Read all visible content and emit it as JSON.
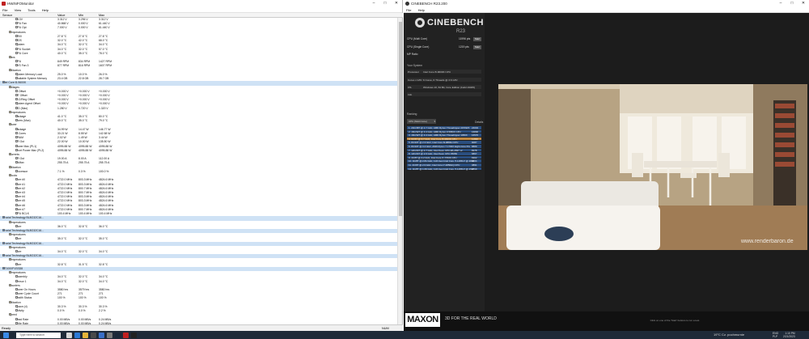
{
  "hwinfo": {
    "title": "HWiNFOMonitor",
    "menu": [
      "File",
      "View",
      "Tools",
      "Help"
    ],
    "columns": [
      "Sensor",
      "Value",
      "Min",
      "Max"
    ],
    "rows": [
      {
        "i": 2,
        "n": "+3.3V",
        "v": "3.312 V",
        "mn": "3.296 V",
        "mx": "3.312 V"
      },
      {
        "i": 2,
        "n": "CPU Fan",
        "v": "40.868 V",
        "mn": "0.000 V",
        "mx": "61.440 V"
      },
      {
        "i": 2,
        "n": "CPU Opt",
        "v": "7.000 V",
        "mn": "0.000 V",
        "mx": "61.440 V"
      },
      {
        "i": 1,
        "n": "Temperatures",
        "h": true
      },
      {
        "i": 2,
        "n": "TZ00",
        "v": "27.8 °C",
        "mn": "27.8 °C",
        "mx": "27.8 °C"
      },
      {
        "i": 2,
        "n": "MOS",
        "v": "32.0 °C",
        "mn": "42.0 °C",
        "mx": "68.0 °C"
      },
      {
        "i": 2,
        "n": "System",
        "v": "34.0 °C",
        "mn": "32.0 °C",
        "mx": "34.0 °C"
      },
      {
        "i": 2,
        "n": "CPU Socket",
        "v": "34.0 °C",
        "mn": "32.0 °C",
        "mx": "57.0 °C"
      },
      {
        "i": 2,
        "n": "CPU Core",
        "v": "40.0 °C",
        "mn": "35.0 °C",
        "mx": "78.0 °C"
      },
      {
        "i": 1,
        "n": "Fans",
        "h": true
      },
      {
        "i": 2,
        "n": "CPU",
        "v": "849 RPM",
        "mn": "834 RPM",
        "mx": "1427 RPM"
      },
      {
        "i": 2,
        "n": "SYS Fan 3",
        "v": "877 RPM",
        "mn": "816 RPM",
        "mx": "1607 RPM"
      },
      {
        "i": 1,
        "n": "Utilization",
        "h": true
      },
      {
        "i": 2,
        "n": "System Memory Load",
        "v": "25.0 %",
        "mn": "10.0 %",
        "mx": "26.0 %"
      },
      {
        "i": 2,
        "n": "Available System Memory",
        "v": "23.4 GB",
        "mn": "22.8 GB",
        "mx": "28.7 GB"
      },
      {
        "i": 0,
        "n": "Intel Core i5-9600K",
        "d": true
      },
      {
        "i": 1,
        "n": "Voltages",
        "h": true
      },
      {
        "i": 2,
        "n": "IA Offset",
        "v": "+0.000 V",
        "mn": "+0.000 V",
        "mx": "+0.000 V"
      },
      {
        "i": 2,
        "n": "GT Offset",
        "v": "+0.000 V",
        "mn": "+0.000 V",
        "mx": "+0.000 V"
      },
      {
        "i": 2,
        "n": "LLC/Ring Offset",
        "v": "+0.000 V",
        "mn": "+0.000 V",
        "mx": "+0.000 V"
      },
      {
        "i": 2,
        "n": "System Agent Offset",
        "v": "+0.000 V",
        "mn": "+0.000 V",
        "mx": "+0.000 V"
      },
      {
        "i": 2,
        "n": "VID (Max)",
        "v": "1.280 V",
        "mn": "0.720 V",
        "mx": "1.320 V"
      },
      {
        "i": 1,
        "n": "Temperatures",
        "h": true
      },
      {
        "i": 2,
        "n": "Package",
        "v": "41.0 °C",
        "mn": "35.0 °C",
        "mx": "80.0 °C"
      },
      {
        "i": 2,
        "n": "Cores (Max)",
        "v": "40.0 °C",
        "mn": "35.0 °C",
        "mx": "79.0 °C"
      },
      {
        "i": 1,
        "n": "Power",
        "h": true
      },
      {
        "i": 2,
        "n": "Package",
        "v": "34.99 W",
        "mn": "14.47 W",
        "mx": "146.77 W"
      },
      {
        "i": 2,
        "n": "IA Cores",
        "v": "33.21 W",
        "mn": "8.55 W",
        "mx": "142.58 W"
      },
      {
        "i": 2,
        "n": "DRAM",
        "v": "2.02 W",
        "mn": "1.49 W",
        "mx": "3.44 W"
      },
      {
        "i": 2,
        "n": "VR Out",
        "v": "22.00 W",
        "mn": "10.00 W",
        "mx": "135.50 W"
      },
      {
        "i": 2,
        "n": "Power Max (PL1)",
        "v": "4095.88 W",
        "mn": "4095.88 W",
        "mx": "4095.88 W"
      },
      {
        "i": 2,
        "n": "Short Power Max (PL2)",
        "v": "4095.88 W",
        "mn": "4095.88 W",
        "mx": "4095.88 W"
      },
      {
        "i": 1,
        "n": "Currents",
        "h": true
      },
      {
        "i": 2,
        "n": "VR Out",
        "v": "19.00 A",
        "mn": "8.00 A",
        "mx": "112.00 A"
      },
      {
        "i": 2,
        "n": "IccMax",
        "v": "255.75 A",
        "mn": "255.75 A",
        "mx": "255.75 A"
      },
      {
        "i": 1,
        "n": "Utilization",
        "h": true
      },
      {
        "i": 2,
        "n": "Processor",
        "v": "7.1 %",
        "mn": "0.3 %",
        "mx": "100.0 %"
      },
      {
        "i": 1,
        "n": "Clocks",
        "h": true
      },
      {
        "i": 2,
        "n": "Core #0",
        "v": "4722.0 MHz",
        "mn": "803.3 MHz",
        "mx": "4824.6 MHz"
      },
      {
        "i": 2,
        "n": "Core #1",
        "v": "4722.0 MHz",
        "mn": "803.3 MHz",
        "mx": "4824.6 MHz"
      },
      {
        "i": 2,
        "n": "Core #2",
        "v": "4722.0 MHz",
        "mn": "800.7 MHz",
        "mx": "4824.6 MHz"
      },
      {
        "i": 2,
        "n": "Core #3",
        "v": "4722.0 MHz",
        "mn": "800.7 MHz",
        "mx": "4824.6 MHz"
      },
      {
        "i": 2,
        "n": "Core #4",
        "v": "4722.0 MHz",
        "mn": "803.3 MHz",
        "mx": "4824.6 MHz"
      },
      {
        "i": 2,
        "n": "Core #5",
        "v": "4722.0 MHz",
        "mn": "803.3 MHz",
        "mx": "4824.6 MHz"
      },
      {
        "i": 2,
        "n": "Core #6",
        "v": "4722.0 MHz",
        "mn": "803.3 MHz",
        "mx": "4824.6 MHz"
      },
      {
        "i": 2,
        "n": "Core #7",
        "v": "4722.0 MHz",
        "mn": "800.7 MHz",
        "mx": "4824.6 MHz"
      },
      {
        "i": 2,
        "n": "CPU BCLK",
        "v": "100.4 MHz",
        "mn": "100.4 MHz",
        "mx": "100.4 MHz"
      },
      {
        "i": 0,
        "n": "Crucial Technology BL8G32C16...",
        "d": true
      },
      {
        "i": 1,
        "n": "Temperatures",
        "h": true
      },
      {
        "i": 2,
        "n": "Core",
        "v": "36.0 °C",
        "mn": "32.8 °C",
        "mx": "36.0 °C"
      },
      {
        "i": 0,
        "n": "Crucial Technology BL8G32C16...",
        "d": true
      },
      {
        "i": 1,
        "n": "Temperatures",
        "h": true
      },
      {
        "i": 2,
        "n": "Core",
        "v": "35.0 °C",
        "mn": "32.0 °C",
        "mx": "35.0 °C"
      },
      {
        "i": 0,
        "n": "Crucial Technology BL8G32C16...",
        "d": true
      },
      {
        "i": 1,
        "n": "Temperatures",
        "h": true
      },
      {
        "i": 2,
        "n": "Core",
        "v": "34.0 °C",
        "mn": "32.0 °C",
        "mx": "34.0 °C"
      },
      {
        "i": 0,
        "n": "Crucial Technology BL8G32C16...",
        "d": true
      },
      {
        "i": 1,
        "n": "Temperatures",
        "h": true
      },
      {
        "i": 2,
        "n": "Core",
        "v": "32.8 °C",
        "mn": "31.5 °C",
        "mx": "32.8 °C"
      },
      {
        "i": 0,
        "n": "CT1000P1SSD8",
        "d": true
      },
      {
        "i": 1,
        "n": "Temperatures",
        "h": true
      },
      {
        "i": 2,
        "n": "Assembly",
        "v": "34.0 °C",
        "mn": "32.0 °C",
        "mx": "34.0 °C"
      },
      {
        "i": 2,
        "n": "Sensor 1",
        "v": "34.0 °C",
        "mn": "32.0 °C",
        "mx": "34.0 °C"
      },
      {
        "i": 1,
        "n": "Counters",
        "h": true
      },
      {
        "i": 2,
        "n": "Power On Hours",
        "v": "3580 hrs",
        "mn": "3579 hrs",
        "mx": "3580 hrs"
      },
      {
        "i": 2,
        "n": "Power Cycle Count",
        "v": "271",
        "mn": "271",
        "mx": "271"
      },
      {
        "i": 2,
        "n": "Health Status",
        "v": "100 %",
        "mn": "100 %",
        "mx": "100 %"
      },
      {
        "i": 1,
        "n": "Utilization",
        "h": true
      },
      {
        "i": 2,
        "n": "Space (d)",
        "v": "30.3 %",
        "mn": "30.3 %",
        "mx": "30.3 %"
      },
      {
        "i": 2,
        "n": "Activity",
        "v": "0.0 %",
        "mn": "0.0 %",
        "mx": "2.2 %"
      },
      {
        "i": 1,
        "n": "Speed",
        "h": true
      },
      {
        "i": 2,
        "n": "Read Rate",
        "v": "0.00 MB/s",
        "mn": "0.00 MB/s",
        "mx": "0.24 MB/s"
      },
      {
        "i": 2,
        "n": "Write Rate",
        "v": "0.00 MB/s",
        "mn": "0.00 MB/s",
        "mx": "0.24 MB/s"
      }
    ],
    "status_left": "Ready",
    "status_right": "NUM"
  },
  "cinebench": {
    "title": "CINEBENCH R23.200",
    "menu": [
      "File",
      "Help"
    ],
    "logo_title": "CINEBENCH",
    "logo_sub": "R23",
    "tests": [
      {
        "label": "CPU (Multi Core)",
        "score": "11996 pts",
        "btn": "Start"
      },
      {
        "label": "CPU (Single Core)",
        "score": "1219 pts",
        "btn": "Start"
      },
      {
        "label": "MP Ratio",
        "score": "",
        "btn": ""
      }
    ],
    "your_system": "Your System",
    "sys": [
      {
        "k": "Processor",
        "v": "Intel Core i5-9600K CPU"
      },
      {
        "k": "Cores x GHz",
        "v": "6 Cores, 6 Threads @ 3.6 GHz"
      },
      {
        "k": "OS",
        "v": "Windows 10, 64 Bit, Core Edition (build 19045)"
      },
      {
        "k": "Info",
        "v": ""
      }
    ],
    "ranking_label": "Ranking",
    "ranking_select": "CPU (Multi Core)",
    "details": "Details",
    "ranking": [
      {
        "n": "1. 24C/48T @ 2.7 GHz, AMD Ryzen Threadripper 2970WX",
        "s": "24004"
      },
      {
        "n": "2. 16C/32T @ 3.4 GHz, AMD Ryzen 9 5950X CPU",
        "s": "16800"
      },
      {
        "n": "3. 16C/32T @ 3.4 GHz, AMD Ryzen Threadripper 1950X",
        "s": "16570"
      },
      {
        "n": "4. 6C/6T @ 3.7 GHz, Intel Core i5-9600K CPU",
        "s": "11996",
        "me": true
      },
      {
        "n": "5. 8C/16T @ 2.3 GHz, Intel Core i9-9880H CPU",
        "s": "9087"
      },
      {
        "n": "6. 8C/16T @ 3.4 GHz, AMD Ryzen 7 1700X Eight-Core Pro",
        "s": "8889"
      },
      {
        "n": "7. 12C/24T @ 2.7 GHz, Intel Xeon CPU E5-2697 v2",
        "s": "8378"
      },
      {
        "n": "8. 12C/24T @ 2.6 GHz, Intel Xeon CPU X5650",
        "s": "6867"
      },
      {
        "n": "9. 4C/8T @ 4.2 GHz, Intel Core i7-7700K CPU",
        "s": "6302"
      },
      {
        "n": "10. 4C/8T @ 2.81 GHz, 11th Gen Intel Core i7-1165G7 @ 28W",
        "s": "4904"
      },
      {
        "n": "11. 4C/8T @ 2.3 GHz, Intel Core i7-4850HQ CPU",
        "s": "3891"
      },
      {
        "n": "12. 4C/8T @ 1.69 GHz, 11th Gen Intel Core i7-1165G7 @ 15W",
        "s": "3769"
      }
    ],
    "legend": [
      "Your Score",
      "Identical System"
    ],
    "brand": "MAXON",
    "tagline": "3D FOR THE REAL WORLD",
    "hint": "Click on one of the 'Start' buttons to run a test.",
    "watermark": "www.renderbaron.de"
  },
  "taskbar": {
    "search": "Type here to search",
    "weather": "19°C  Cz. pochmurnie",
    "time": "1:10 PM",
    "date": "2/21/2023",
    "lang": "ENG PLP"
  },
  "colors": {
    "cb_bar": "#2b4f80",
    "cb_me": "#b07a3a",
    "device_row": "#cfe2f5"
  }
}
